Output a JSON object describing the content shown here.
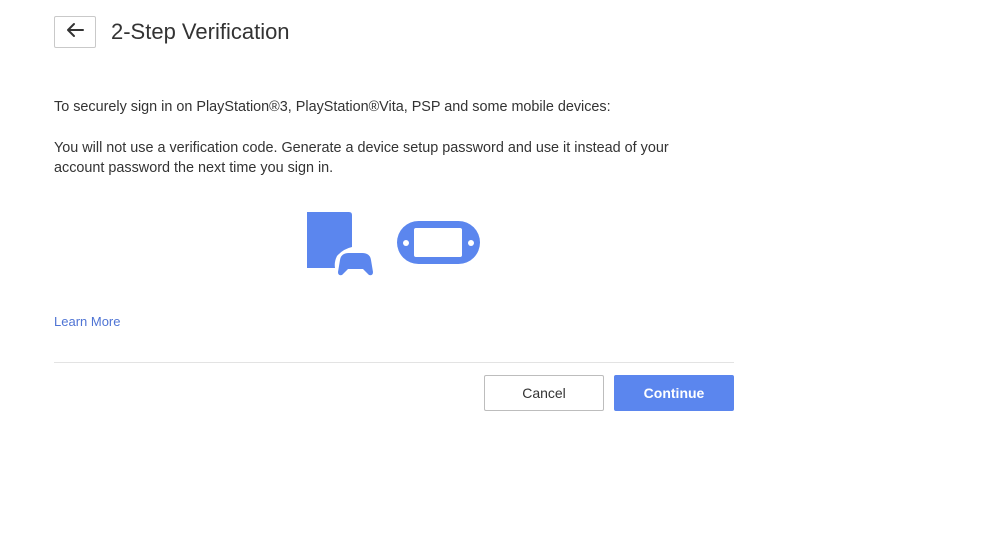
{
  "header": {
    "back_icon": "arrow-left-icon",
    "title": "2-Step Verification"
  },
  "content": {
    "intro": "To securely sign in on PlayStation®3, PlayStation®Vita, PSP and some mobile devices:",
    "description": "You will not use a verification code. Generate a device setup password and use it instead of your account password the next time you sign in.",
    "icons": [
      "ps3-console-icon",
      "ps-vita-icon"
    ],
    "learn_more": "Learn More"
  },
  "footer": {
    "cancel_label": "Cancel",
    "continue_label": "Continue"
  },
  "colors": {
    "accent": "#5b86ee",
    "link": "#4f74d4",
    "icon": "#5b86ee"
  }
}
